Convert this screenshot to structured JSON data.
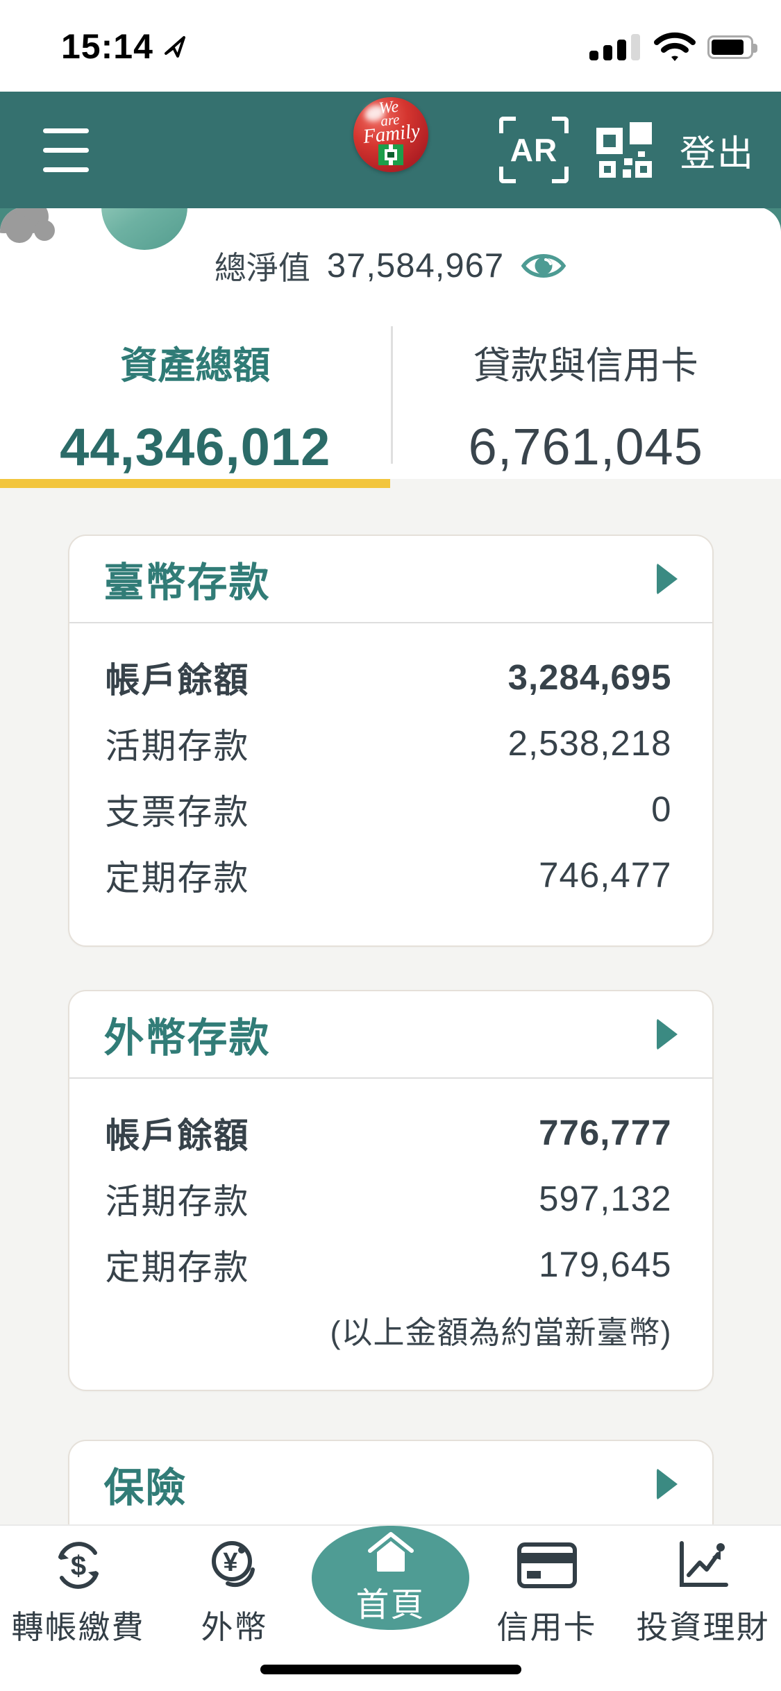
{
  "status_bar": {
    "time": "15:14"
  },
  "header": {
    "logo": {
      "line1": "We",
      "line2": "are",
      "line3": "Family"
    },
    "ar_label": "AR",
    "logout_label": "登出"
  },
  "summary": {
    "label": "總淨值",
    "value": "37,584,967"
  },
  "tabs": {
    "left": {
      "label": "資產總額",
      "value": "44,346,012",
      "active": true
    },
    "right": {
      "label": "貸款與信用卡",
      "value": "6,761,045",
      "active": false
    }
  },
  "cards": [
    {
      "title": "臺幣存款",
      "rows": [
        {
          "label": "帳戶餘額",
          "value": "3,284,695",
          "bold": true
        },
        {
          "label": "活期存款",
          "value": "2,538,218"
        },
        {
          "label": "支票存款",
          "value": "0"
        },
        {
          "label": "定期存款",
          "value": "746,477"
        }
      ]
    },
    {
      "title": "外幣存款",
      "rows": [
        {
          "label": "帳戶餘額",
          "value": "776,777",
          "bold": true
        },
        {
          "label": "活期存款",
          "value": "597,132"
        },
        {
          "label": "定期存款",
          "value": "179,645"
        }
      ],
      "note": "(以上金額為約當新臺幣)"
    },
    {
      "title": "保險",
      "rows": []
    }
  ],
  "tabbar": {
    "items": [
      {
        "label": "轉帳繳費",
        "icon": "transfer-icon"
      },
      {
        "label": "外幣",
        "icon": "foreign-currency-icon"
      },
      {
        "label": "首頁",
        "icon": "home-icon",
        "active": true
      },
      {
        "label": "信用卡",
        "icon": "credit-card-icon"
      },
      {
        "label": "投資理財",
        "icon": "investment-icon"
      }
    ]
  },
  "colors": {
    "header_teal": "#35716F",
    "sheet_corner_teal": "#478A80",
    "accent_teal": "#317C77",
    "pill_teal": "#4F9C94",
    "big_number_teal": "#2B6B68",
    "indicator_yellow": "#F2C53D",
    "text_dark": "#37424A",
    "page_bg": "#F4F4F2",
    "logo_red": "#C5242B"
  }
}
